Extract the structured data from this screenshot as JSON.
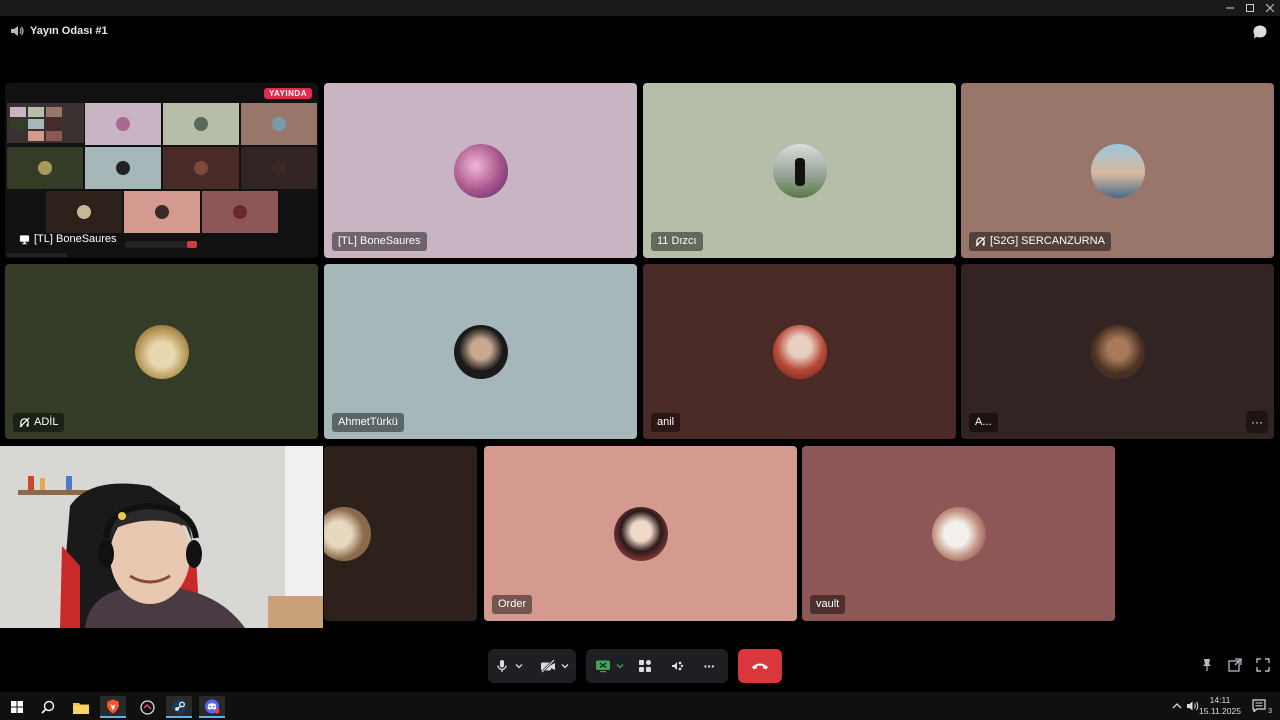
{
  "window": {
    "controls": [
      "minimize",
      "maximize",
      "close"
    ]
  },
  "header": {
    "title": "Yayın Odası #1",
    "icon": "speaker-icon",
    "chat_icon": "chat-bubble-icon"
  },
  "tiles": [
    {
      "name": "[TL] BoneSaures",
      "kind": "stream",
      "badge": "YAYINDA",
      "bg": "#0c0c0c",
      "label_icon": "monitor-icon"
    },
    {
      "name": "[TL] BoneSaures",
      "kind": "avatar",
      "bg": "#c8b4c2"
    },
    {
      "name": "11 Dızcı",
      "kind": "avatar",
      "bg": "#b6beaa"
    },
    {
      "name": "[S2G] SERCANZURNA",
      "kind": "avatar",
      "bg": "#98766a",
      "label_icon": "deafened-icon"
    },
    {
      "name": "ADİL",
      "kind": "avatar",
      "bg": "#343c28",
      "label_icon": "deafened-icon"
    },
    {
      "name": "AhmetTürkü",
      "kind": "avatar",
      "bg": "#a6b7ba"
    },
    {
      "name": "anil",
      "kind": "avatar",
      "bg": "#4a2a26"
    },
    {
      "name": "A...",
      "kind": "avatar",
      "bg": "#312422",
      "more": "···"
    },
    {
      "name": "",
      "kind": "avatar-partial",
      "bg": "#2e211c"
    },
    {
      "name": "Order",
      "kind": "avatar",
      "bg": "#d49a90"
    },
    {
      "name": "vault",
      "kind": "avatar",
      "bg": "#8c5756"
    }
  ],
  "controls": {
    "mic": "microphone-icon",
    "camera": "camera-off-icon",
    "screenshare": "screen-share-icon",
    "activities": "activities-icon",
    "soundboard": "soundboard-icon",
    "more": "more-icon",
    "hangup": "hangup-icon",
    "more_label": "···"
  },
  "taskbar": {
    "time": "14:11",
    "date": "15.11.2025",
    "notification_count": "3",
    "apps": [
      "start-icon",
      "search-icon",
      "file-explorer-icon",
      "brave-icon",
      "app-icon",
      "steam-icon",
      "discord-icon"
    ]
  },
  "colors": {
    "hangup": "#da373c",
    "live": "#e5294b",
    "screenshare": "#3ba55c"
  }
}
